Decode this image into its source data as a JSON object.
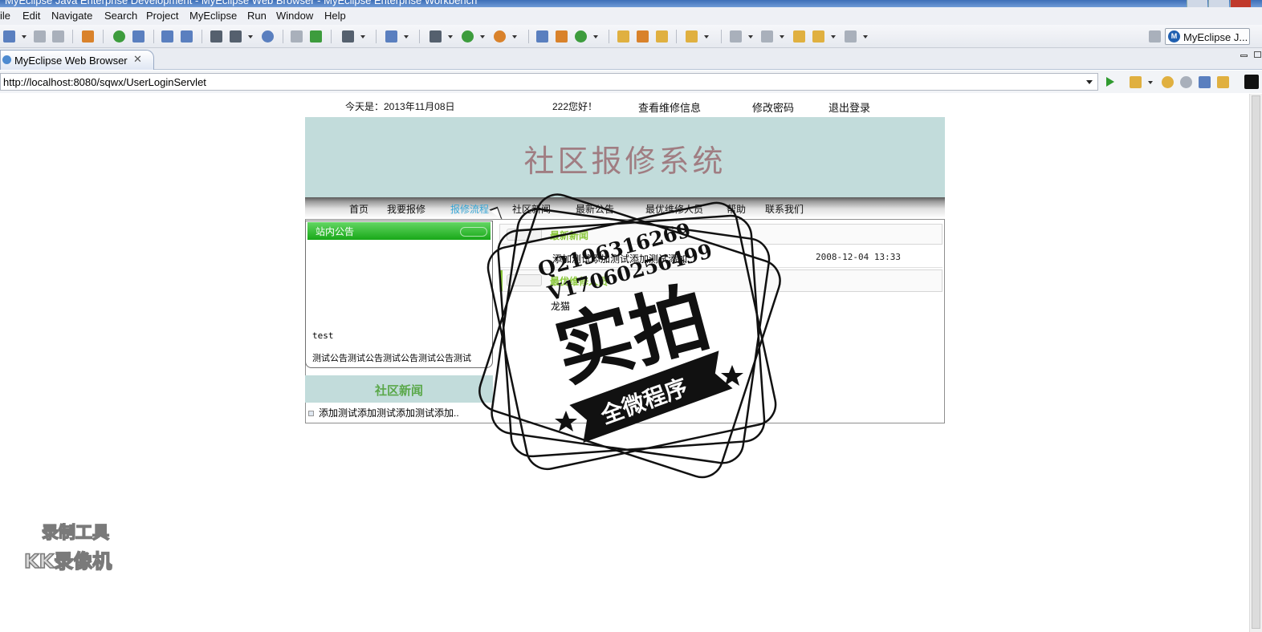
{
  "window": {
    "title": "MyEclipse Java Enterprise Development - MyEclipse Web Browser - MyEclipse Enterprise Workbench"
  },
  "menu": [
    "ile",
    "Edit",
    "Navigate",
    "Search",
    "Project",
    "MyEclipse",
    "Run",
    "Window",
    "Help"
  ],
  "perspective": {
    "label": "MyEclipse J..."
  },
  "editor_tab": {
    "label": "MyEclipse Web Browser",
    "close": "✕"
  },
  "browser": {
    "url": "http://localhost:8080/sqwx/UserLoginServlet"
  },
  "page": {
    "top": {
      "date": "今天是：2013年11月08日",
      "greeting": "222您好！",
      "view_repairs": "查看维修信息",
      "change_password": "修改密码",
      "logout": "退出登录"
    },
    "banner_title": "社区报修系统",
    "nav": [
      "首页",
      "我要报修",
      "报修流程",
      "社区新闻",
      "最新公告",
      "最优维修人员",
      "帮助",
      "联系我们"
    ],
    "nav_active_index": 2,
    "notice": {
      "header": "站内公告",
      "items": [
        "test",
        "测试公告测试公告测试公告测试公告测试"
      ]
    },
    "community_news": {
      "header": "社区新闻",
      "items": [
        "添加测试添加测试添加测试添加.."
      ]
    },
    "latest_news": {
      "header": "最新新闻",
      "row_text": "添加测试添加测试添加测试添加..",
      "row_date": "2008-12-04 13:33"
    },
    "best_staff": {
      "header": "最优维修人员",
      "name": "龙猫"
    }
  },
  "watermark": {
    "qq": "Q2196316269",
    "v": "V17060256499",
    "big": "实拍",
    "ribbon": "全微程序",
    "recorder_line1": "录制工具",
    "recorder_line2": "KK录像机"
  }
}
